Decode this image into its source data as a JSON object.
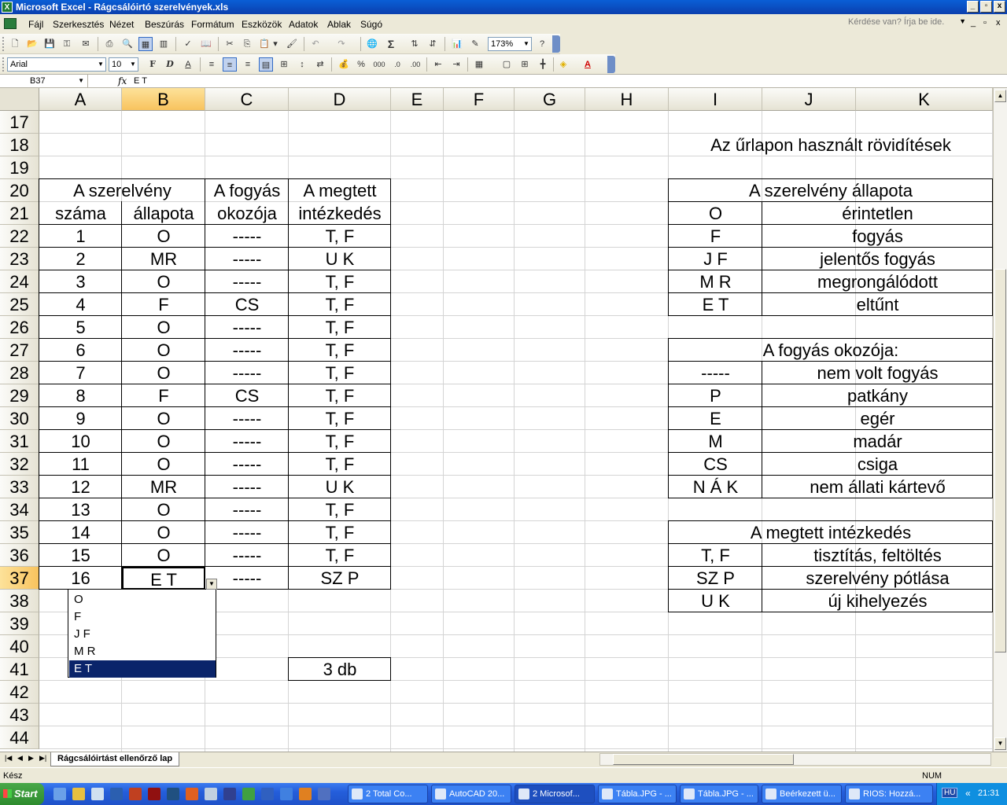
{
  "window": {
    "title": "Microsoft Excel - Rágcsálóirtó szerelvények.xls",
    "min": "_",
    "restore": "▫",
    "close": "x"
  },
  "menu": {
    "items": [
      "Fájl",
      "Szerkesztés",
      "Nézet",
      "Beszúrás",
      "Formátum",
      "Eszközök",
      "Adatok",
      "Ablak",
      "Súgó"
    ],
    "ask_placeholder": "Kérdése van? Írja be ide.",
    "doc_min": "_",
    "doc_restore": "▫",
    "doc_close": "x"
  },
  "toolbar": {
    "zoom": "173%",
    "font": "Arial",
    "size": "10",
    "bold": "F",
    "italic": "D",
    "underline": "A",
    "sigma": "Σ",
    "percent": "%",
    "thousands": "000"
  },
  "formula": {
    "cell": "B37",
    "fx": "fx",
    "value": "E T"
  },
  "columns": [
    "A",
    "B",
    "C",
    "D",
    "E",
    "F",
    "G",
    "H",
    "I",
    "J",
    "K"
  ],
  "rows": [
    "17",
    "18",
    "19",
    "20",
    "21",
    "22",
    "23",
    "24",
    "25",
    "26",
    "27",
    "28",
    "29",
    "30",
    "31",
    "32",
    "33",
    "34",
    "35",
    "36",
    "37",
    "38",
    "39",
    "40",
    "41",
    "42",
    "43",
    "44"
  ],
  "table": {
    "header1": {
      "a": "A szerelvény",
      "c": "A fogyás",
      "d": "A megtett"
    },
    "header2": {
      "a": "száma",
      "b": "állapota",
      "c": "okozója",
      "d": "intézkedés"
    },
    "rows": [
      [
        "1",
        "O",
        "-----",
        "T, F"
      ],
      [
        "2",
        "MR",
        "-----",
        "U K"
      ],
      [
        "3",
        "O",
        "-----",
        "T, F"
      ],
      [
        "4",
        "F",
        "CS",
        "T, F"
      ],
      [
        "5",
        "O",
        "-----",
        "T, F"
      ],
      [
        "6",
        "O",
        "-----",
        "T, F"
      ],
      [
        "7",
        "O",
        "-----",
        "T, F"
      ],
      [
        "8",
        "F",
        "CS",
        "T, F"
      ],
      [
        "9",
        "O",
        "-----",
        "T, F"
      ],
      [
        "10",
        "O",
        "-----",
        "T, F"
      ],
      [
        "11",
        "O",
        "-----",
        "T, F"
      ],
      [
        "12",
        "MR",
        "-----",
        "U K"
      ],
      [
        "13",
        "O",
        "-----",
        "T, F"
      ],
      [
        "14",
        "O",
        "-----",
        "T, F"
      ],
      [
        "15",
        "O",
        "-----",
        "T, F"
      ],
      [
        "16",
        "E T",
        "-----",
        "SZ P"
      ]
    ],
    "total": "3 db"
  },
  "legend": {
    "title": "Az űrlapon használt rövidítések",
    "state_title": "A szerelvény állapota",
    "state": [
      [
        "O",
        "érintetlen"
      ],
      [
        "F",
        "fogyás"
      ],
      [
        "J F",
        "jelentős fogyás"
      ],
      [
        "M R",
        "megrongálódott"
      ],
      [
        "E T",
        "eltűnt"
      ]
    ],
    "cause_title": "A fogyás okozója:",
    "cause": [
      [
        "-----",
        "nem volt fogyás"
      ],
      [
        "P",
        "patkány"
      ],
      [
        "E",
        "egér"
      ],
      [
        "M",
        "madár"
      ],
      [
        "CS",
        "csiga"
      ],
      [
        "N Á K",
        "nem állati kártevő"
      ]
    ],
    "action_title": "A megtett intézkedés",
    "action": [
      [
        "T, F",
        "tisztítás, feltöltés"
      ],
      [
        "SZ P",
        "szerelvény pótlása"
      ],
      [
        "U K",
        "új kihelyezés"
      ]
    ]
  },
  "dropdown": {
    "options": [
      "O",
      "F",
      "J F",
      "M R",
      "E T"
    ],
    "selected": "E T"
  },
  "sheet_tab": "Rágcsálóirtást ellenőrző lap",
  "status": {
    "left": "Kész",
    "num": "NUM"
  },
  "taskbar": {
    "start": "Start",
    "tasks": [
      "2 Total Co...",
      "AutoCAD 20...",
      "2 Microsof...",
      "Tábla.JPG - ...",
      "Tábla.JPG - ...",
      "Beérkezett ü...",
      "RIOS: Hozzá..."
    ],
    "lang": "HU",
    "clock": "21:31",
    "chevron": "«"
  }
}
